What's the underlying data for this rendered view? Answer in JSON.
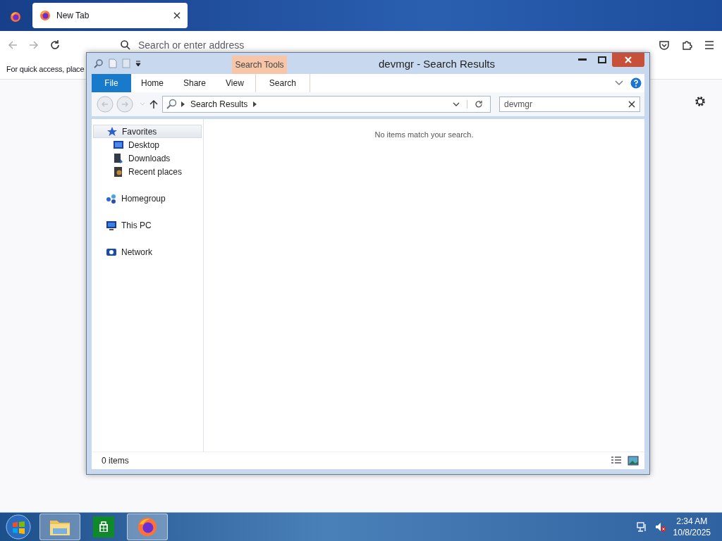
{
  "browser": {
    "tabs": [
      {
        "label": "New Tab",
        "selected": true
      }
    ],
    "address": {
      "placeholder": "Search or enter address"
    },
    "bookmarks_hint": "For quick access, place"
  },
  "explorer": {
    "title": "devmgr - Search Results",
    "contextual_group": "Search Tools",
    "ribbon_tabs": [
      {
        "label": "File",
        "kind": "file"
      },
      {
        "label": "Home",
        "kind": "normal"
      },
      {
        "label": "Share",
        "kind": "normal"
      },
      {
        "label": "View",
        "kind": "normal"
      },
      {
        "label": "Search",
        "kind": "contextual"
      }
    ],
    "breadcrumb": [
      "Search Results"
    ],
    "search": {
      "value": "devmgr"
    },
    "navigation": [
      {
        "label": "Favorites",
        "kind": "star",
        "selected": true,
        "children": [
          {
            "label": "Desktop",
            "kind": "desktop",
            "selected": false
          },
          {
            "label": "Downloads",
            "kind": "downloads",
            "selected": false
          },
          {
            "label": "Recent places",
            "kind": "recent",
            "selected": false
          }
        ]
      },
      {
        "label": "Homegroup",
        "kind": "homegroup",
        "selected": false
      },
      {
        "label": "This PC",
        "kind": "pc",
        "selected": false
      },
      {
        "label": "Network",
        "kind": "network",
        "selected": false
      }
    ],
    "message": "No items match your search.",
    "status": "0 items"
  },
  "taskbar": {
    "items": [
      {
        "kind": "explorer",
        "selected": true
      },
      {
        "kind": "store",
        "selected": false
      },
      {
        "kind": "firefox",
        "selected": true
      }
    ],
    "time": "2:34 AM",
    "date": "10/8/2025"
  }
}
